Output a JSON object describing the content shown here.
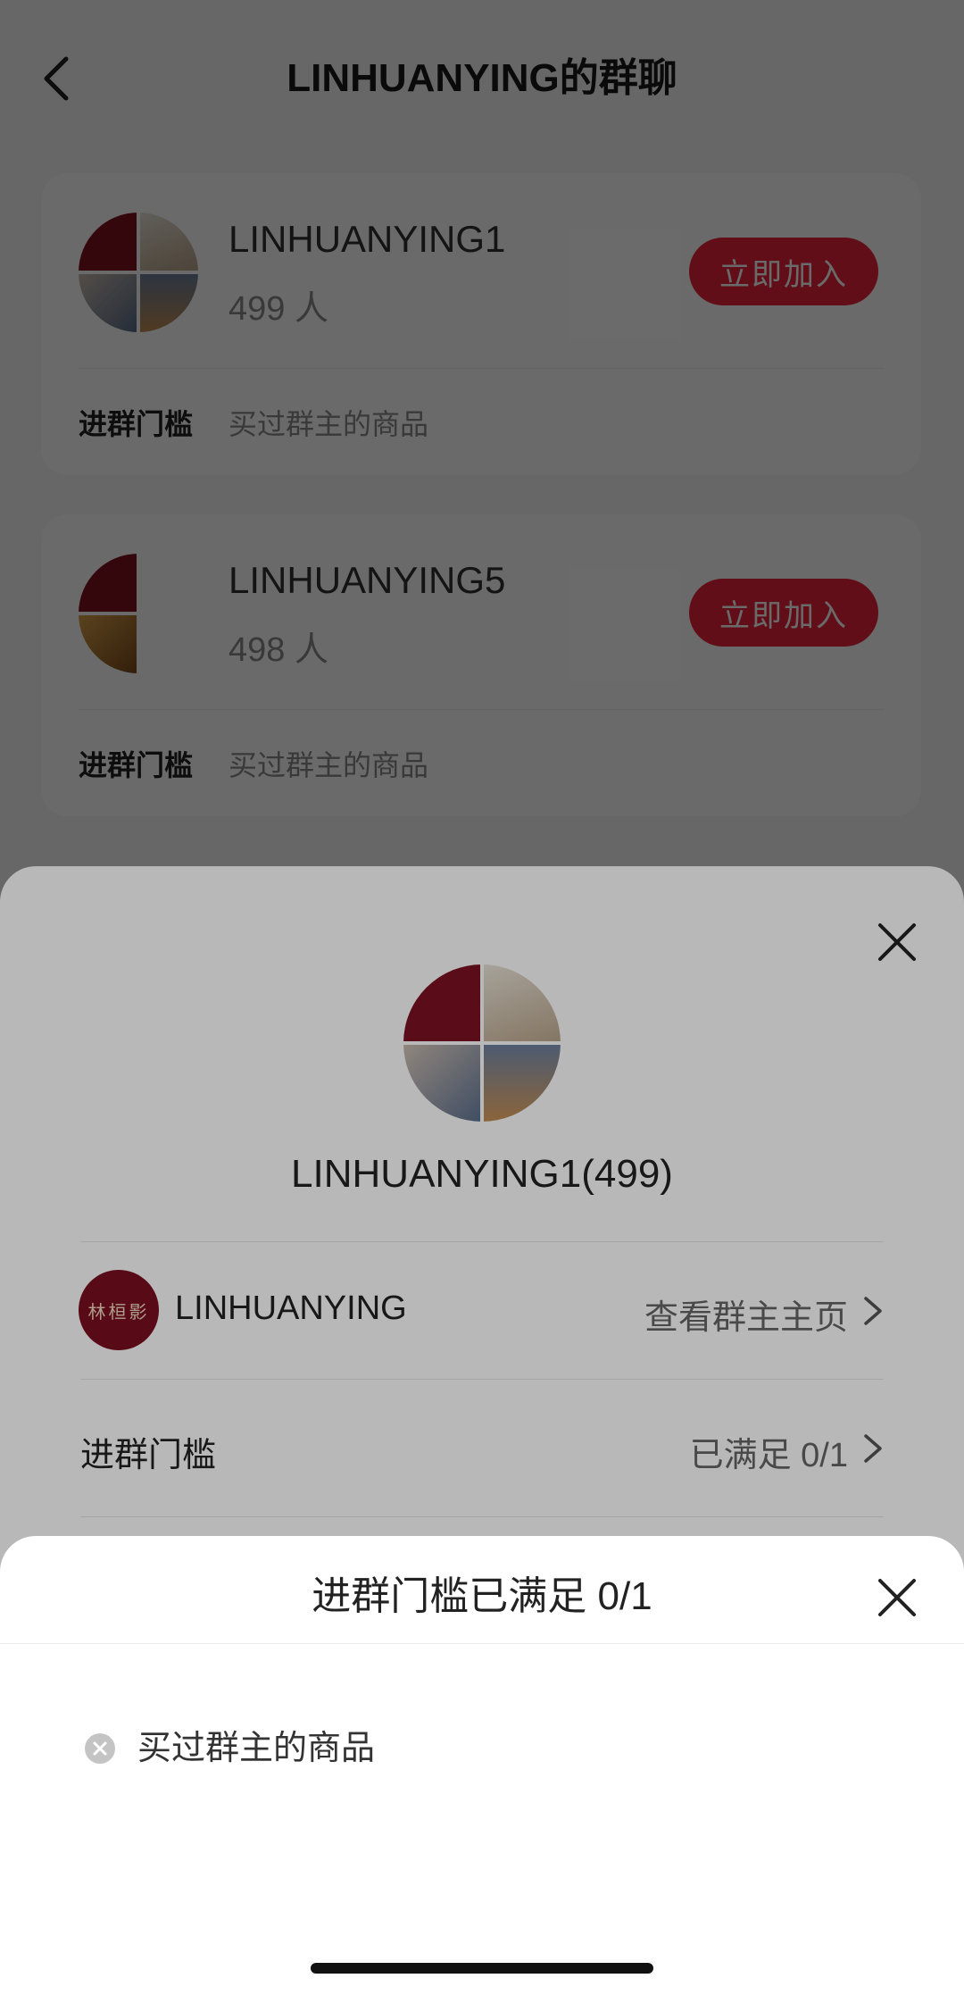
{
  "header": {
    "title": "LINHUANYING的群聊"
  },
  "groups": [
    {
      "name": "LINHUANYING1",
      "members": "499 人",
      "join_label": "立即加入",
      "threshold_label": "进群门槛",
      "threshold_value": "买过群主的商品"
    },
    {
      "name": "LINHUANYING5",
      "members": "498 人",
      "join_label": "立即加入",
      "threshold_label": "进群门槛",
      "threshold_value": "买过群主的商品"
    }
  ],
  "detail_sheet": {
    "title": "LINHUANYING1(499)",
    "owner_avatar_text": "林桓影",
    "owner_name": "LINHUANYING",
    "owner_link": "查看群主主页",
    "threshold_label": "进群门槛",
    "threshold_status": "已满足 0/1"
  },
  "threshold_sheet": {
    "title": "进群门槛已满足 0/1",
    "conditions": [
      {
        "text": "买过群主的商品",
        "met": false
      }
    ]
  },
  "colors": {
    "accent": "#e8243b",
    "brand_dark": "#7a1020"
  }
}
